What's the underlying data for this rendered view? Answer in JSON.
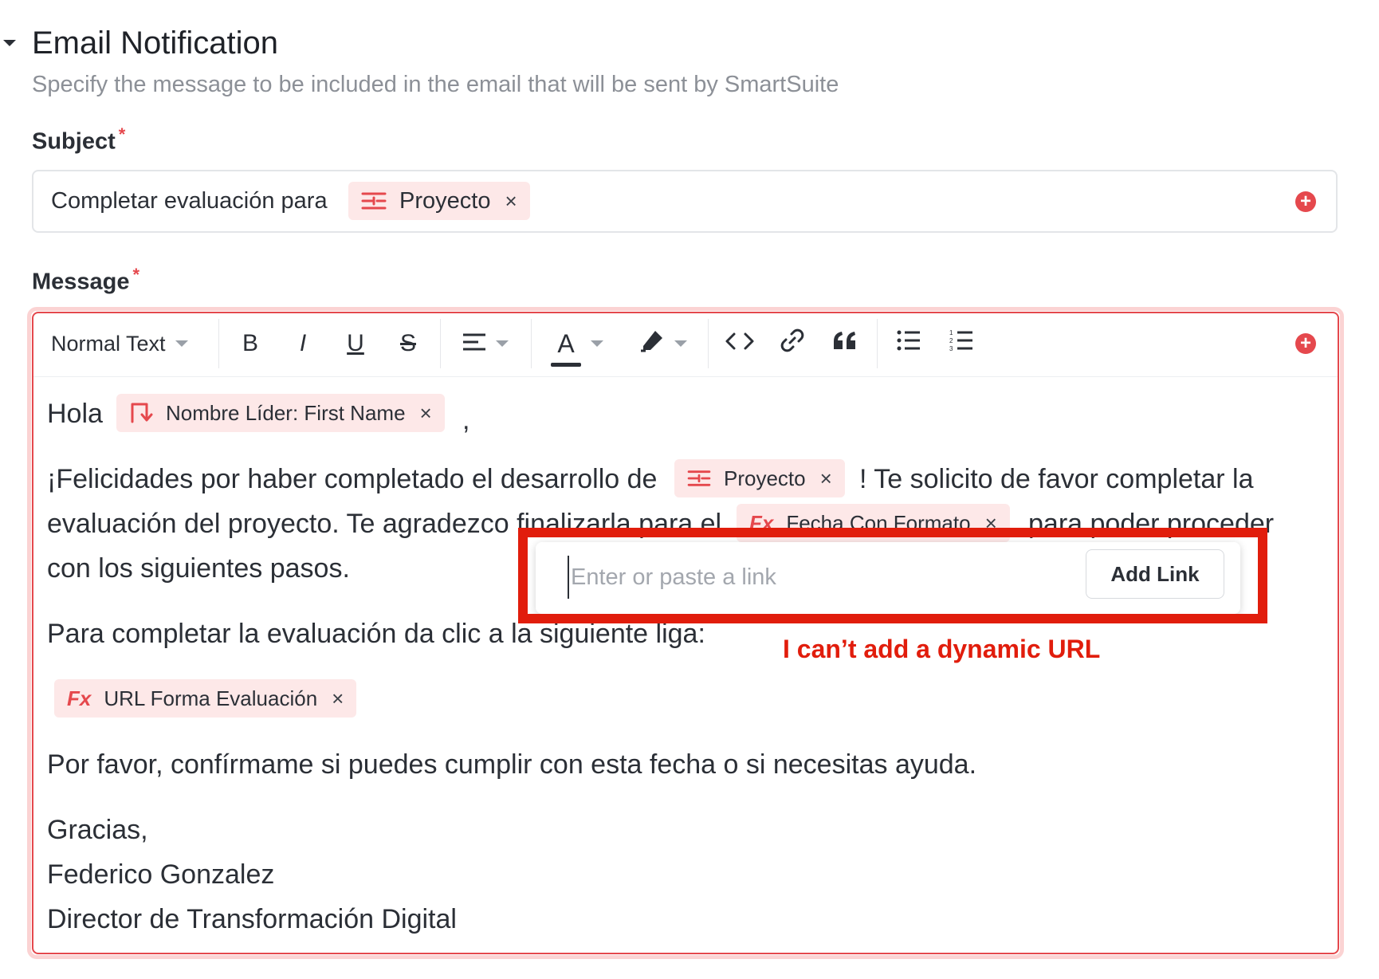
{
  "section": {
    "title": "Email Notification",
    "subtitle": "Specify the message to be included in the email that will be sent by SmartSuite"
  },
  "subject": {
    "label": "Subject",
    "required_mark": "*",
    "text": "Completar evaluación para",
    "chip": {
      "label": "Proyecto",
      "icon": "sliders-icon",
      "remove": "×"
    }
  },
  "message": {
    "label": "Message",
    "required_mark": "*",
    "toolbar": {
      "text_style": "Normal Text",
      "bold": "B",
      "italic": "I",
      "underline": "U",
      "strike": "S",
      "text_color": "A"
    },
    "body": {
      "greeting": "Hola",
      "greeting_chip": {
        "label": "Nombre Líder: First Name",
        "icon": "linked-record-icon",
        "remove": "×"
      },
      "comma": ",",
      "p1_line1_pre": "¡Felicidades por haber completado el desarrollo de",
      "p1_chip": {
        "label": "Proyecto",
        "icon": "sliders-icon",
        "remove": "×"
      },
      "p1_line1_post": "! Te solicito de favor completar la",
      "p1_line2_pre": "evaluación del proyecto. Te agradezco finalizarla para el",
      "p1_chip2": {
        "label": "Fecha Con Formato",
        "icon": "fx",
        "remove": "×"
      },
      "p1_line2_post": "para poder proceder",
      "p1_line3": "con los siguientes pasos.",
      "p2": "Para completar la evaluación da clic a la siguiente liga:",
      "url_chip": {
        "label": "URL Forma Evaluación",
        "icon": "fx",
        "remove": "×"
      },
      "p3": "Por favor, confírmame si puedes cumplir con esta fecha o si necesitas ayuda.",
      "sign1": "Gracias,",
      "sign2": "Federico Gonzalez",
      "sign3": "Director de Transformación Digital"
    }
  },
  "link_popup": {
    "placeholder": "Enter or paste a link",
    "button": "Add Link"
  },
  "annotation": {
    "text": "I can’t add a dynamic URL",
    "color": "#e11d0c"
  },
  "colors": {
    "accent": "#e5484d",
    "chip_bg": "#fde8e8"
  }
}
